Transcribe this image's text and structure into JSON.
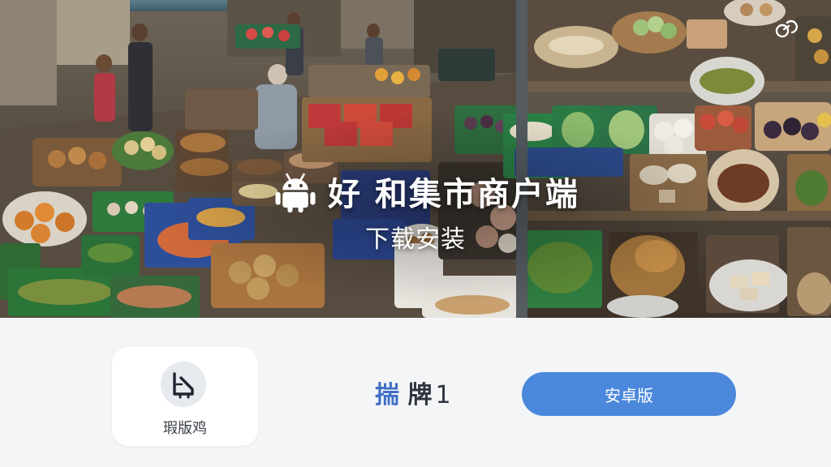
{
  "banner": {
    "headline": "好 和集市商户端",
    "subline": "下载安装",
    "platform_icon": "android-icon",
    "corner_icon": "link-icon"
  },
  "app_card": {
    "icon": "piano-icon",
    "label": "瑕版鸡"
  },
  "platform_info": {
    "prefix": "揣",
    "name": "牌",
    "count": "1"
  },
  "download_button": {
    "label": "安卓版"
  },
  "colors": {
    "accent": "#4b88db",
    "panel_bg": "#f4f5f7",
    "card_bg": "#ffffff",
    "text_dark": "#2f3540"
  }
}
